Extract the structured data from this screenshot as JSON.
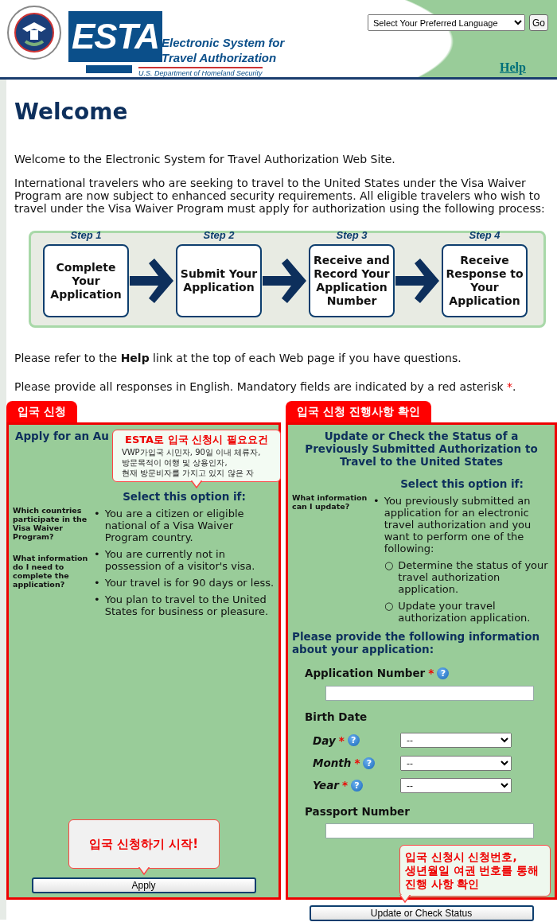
{
  "header": {
    "logo": {
      "wordmark": "ESTA",
      "title_lines": [
        "Electronic System for",
        "Travel Authorization"
      ],
      "subtitle": "U.S. Department of Homeland Security"
    },
    "language_select": {
      "value": "Select Your Preferred Language"
    },
    "go_button": "Go",
    "help_link": "Help"
  },
  "welcome": {
    "title": "Welcome",
    "paragraphs": [
      "Welcome to the Electronic System for Travel Authorization Web Site.",
      "International travelers who are seeking to travel to the United States under the Visa Waiver Program are now subject to enhanced security requirements. All eligible travelers who wish to travel under the Visa Waiver Program must apply for authorization using the following process:"
    ]
  },
  "steps": [
    {
      "label": "Step 1",
      "text": "Complete Your Application"
    },
    {
      "label": "Step 2",
      "text": "Submit Your Application"
    },
    {
      "label": "Step 3",
      "text": "Receive and Record Your Application Number"
    },
    {
      "label": "Step 4",
      "text": "Receive Response to Your Application"
    }
  ],
  "help_note": {
    "before": "Please refer to the ",
    "link": "Help",
    "after": " link at the top of each Web page if you have questions."
  },
  "mandatory_note": {
    "text": "Please provide all responses in English. Mandatory fields are indicated by a red asterisk ",
    "asterisk": "*",
    "end": "."
  },
  "panels": [
    {
      "tab": "입국 신청",
      "heading": "Apply for an Au",
      "requirements_callout": {
        "title": "ESTA로 입국 신청시 필요요건",
        "lines": [
          "VWP가입국 시민자, 90일 이내 체류자,",
          "방문목적이 여행 및 상용인자,",
          "현재 방문비자를 가지고 있지 않은 자"
        ]
      },
      "links": [
        "Which countries participate in the Visa Waiver Program?",
        "What information do I need to complete the application?"
      ],
      "condition_heading": "Select this option if:",
      "conditions": [
        {
          "bullet": "•",
          "text": "You are a citizen or eligible national of a Visa Waiver Program country."
        },
        {
          "bullet": "•",
          "text": "You are currently not in possession of a visitor's visa."
        },
        {
          "bullet": "•",
          "text": "Your travel is for 90 days or less."
        },
        {
          "bullet": "•",
          "text": "You plan to travel to the United States for business or pleasure."
        }
      ],
      "action_callout": {
        "lines": [
          "입국 신청하기 시작!"
        ]
      },
      "button": "Apply"
    },
    {
      "tab": "입국 신청 진행사항 확인",
      "heading": "Update or Check the Status of a Previously Submitted Authorization to Travel to the United States",
      "links": [
        "What information can I update?"
      ],
      "condition_heading": "Select this option if:",
      "conditions": [
        {
          "bullet": "•",
          "text": "You previously submitted an application for an electronic travel authorization and you want to perform one of the following:",
          "children": [
            {
              "bullet": "○",
              "text": "Determine the status of your travel authorization application."
            },
            {
              "bullet": "○",
              "text": "Update your travel authorization application."
            }
          ]
        }
      ],
      "form": {
        "heading": "Please provide the following information about your application:",
        "fields": [
          {
            "kind": "text",
            "label": "Application Number",
            "asterisk": "*",
            "help": "?"
          },
          {
            "kind": "group",
            "label": "Birth Date"
          },
          {
            "kind": "select",
            "label": "Day",
            "asterisk": "*",
            "help": "?",
            "value": "--"
          },
          {
            "kind": "select",
            "label": "Month",
            "asterisk": "*",
            "help": "?",
            "value": "--"
          },
          {
            "kind": "select",
            "label": "Year",
            "asterisk": "*",
            "help": "?",
            "value": "--"
          },
          {
            "kind": "text",
            "label": "Passport Number"
          }
        ]
      },
      "action_callout": {
        "lines": [
          "입국 신청시 신청번호,",
          "생년월일 여권 번호를 통해",
          "진행 사항 확인"
        ]
      },
      "button": "Update or Check Status"
    }
  ]
}
